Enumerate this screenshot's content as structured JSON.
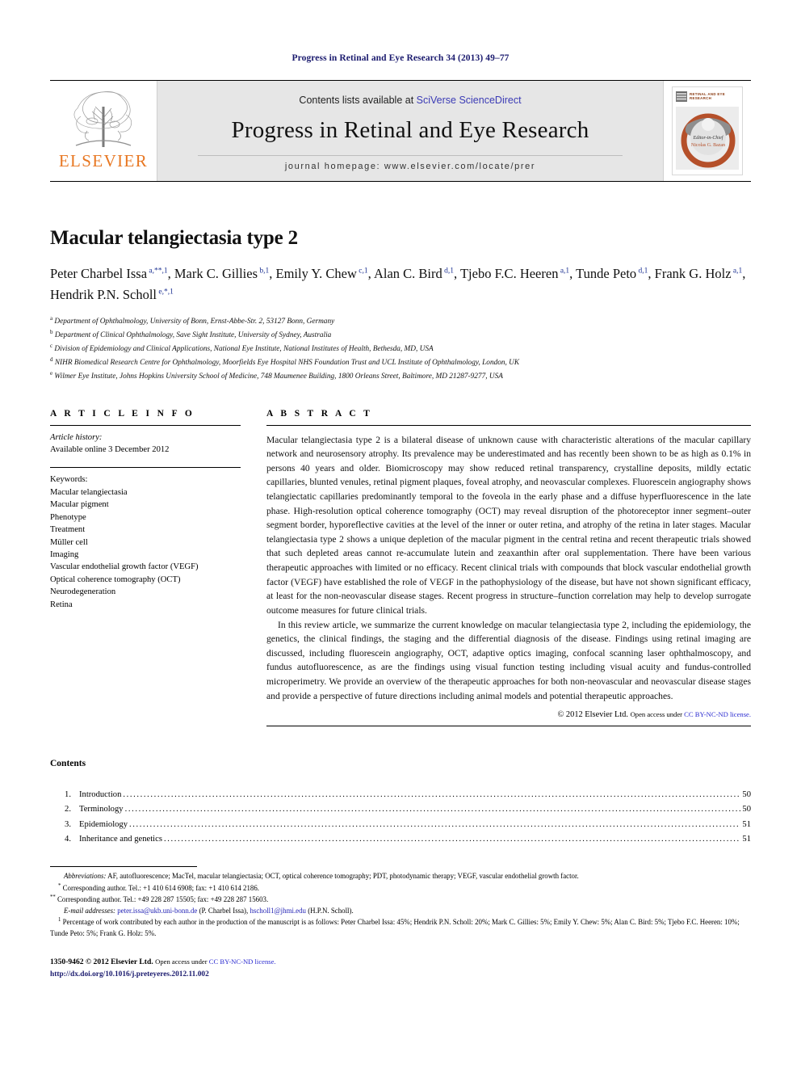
{
  "running_head": "Progress in Retinal and Eye Research 34 (2013) 49–77",
  "masthead": {
    "publisher_name": "ELSEVIER",
    "contents_prefix": "Contents lists available at ",
    "sciencedirect_link": "SciVerse ScienceDirect",
    "journal_title": "Progress in Retinal and Eye Research",
    "homepage_line": "journal homepage: www.elsevier.com/locate/prer",
    "cover_title": "RETINAL AND EYE RESEARCH",
    "cover_editor_label": "Editor-in-Chief",
    "cover_editor_name": "Nicolas G. Bazan"
  },
  "article": {
    "title": "Macular telangiectasia type 2",
    "authors": [
      {
        "name": "Peter Charbel Issa",
        "sup": "a,**,1"
      },
      {
        "name": "Mark C. Gillies",
        "sup": "b,1"
      },
      {
        "name": "Emily Y. Chew",
        "sup": "c,1"
      },
      {
        "name": "Alan C. Bird",
        "sup": "d,1"
      },
      {
        "name": "Tjebo F.C. Heeren",
        "sup": "a,1"
      },
      {
        "name": "Tunde Peto",
        "sup": "d,1"
      },
      {
        "name": "Frank G. Holz",
        "sup": "a,1"
      },
      {
        "name": "Hendrik P.N. Scholl",
        "sup": "e,*,1"
      }
    ],
    "affiliations": [
      {
        "label": "a",
        "text": "Department of Ophthalmology, University of Bonn, Ernst-Abbe-Str. 2, 53127 Bonn, Germany"
      },
      {
        "label": "b",
        "text": "Department of Clinical Ophthalmology, Save Sight Institute, University of Sydney, Australia"
      },
      {
        "label": "c",
        "text": "Division of Epidemiology and Clinical Applications, National Eye Institute, National Institutes of Health, Bethesda, MD, USA"
      },
      {
        "label": "d",
        "text": "NIHR Biomedical Research Centre for Ophthalmology, Moorfields Eye Hospital NHS Foundation Trust and UCL Institute of Ophthalmology, London, UK"
      },
      {
        "label": "e",
        "text": "Wilmer Eye Institute, Johns Hopkins University School of Medicine, 748 Maumenee Building, 1800 Orleans Street, Baltimore, MD 21287-9277, USA"
      }
    ]
  },
  "article_info": {
    "heading": "A R T I C L E    I N F O",
    "history_label": "Article history:",
    "history_value": "Available online 3 December 2012",
    "keywords_label": "Keywords:",
    "keywords": [
      "Macular telangiectasia",
      "Macular pigment",
      "Phenotype",
      "Treatment",
      "Müller cell",
      "Imaging",
      "Vascular endothelial growth factor (VEGF)",
      "Optical coherence tomography (OCT)",
      "Neurodegeneration",
      "Retina"
    ]
  },
  "abstract": {
    "heading": "A B S T R A C T",
    "paragraph_1": "Macular telangiectasia type 2 is a bilateral disease of unknown cause with characteristic alterations of the macular capillary network and neurosensory atrophy. Its prevalence may be underestimated and has recently been shown to be as high as 0.1% in persons 40 years and older. Biomicroscopy may show reduced retinal transparency, crystalline deposits, mildly ectatic capillaries, blunted venules, retinal pigment plaques, foveal atrophy, and neovascular complexes. Fluorescein angiography shows telangiectatic capillaries predominantly temporal to the foveola in the early phase and a diffuse hyperfluorescence in the late phase. High-resolution optical coherence tomography (OCT) may reveal disruption of the photoreceptor inner segment–outer segment border, hyporeflective cavities at the level of the inner or outer retina, and atrophy of the retina in later stages. Macular telangiectasia type 2 shows a unique depletion of the macular pigment in the central retina and recent therapeutic trials showed that such depleted areas cannot re-accumulate lutein and zeaxanthin after oral supplementation. There have been various therapeutic approaches with limited or no efficacy. Recent clinical trials with compounds that block vascular endothelial growth factor (VEGF) have established the role of VEGF in the pathophysiology of the disease, but have not shown significant efficacy, at least for the non-neovascular disease stages. Recent progress in structure–function correlation may help to develop surrogate outcome measures for future clinical trials.",
    "paragraph_2": "In this review article, we summarize the current knowledge on macular telangiectasia type 2, including the epidemiology, the genetics, the clinical findings, the staging and the differential diagnosis of the disease. Findings using retinal imaging are discussed, including fluorescein angiography, OCT, adaptive optics imaging, confocal scanning laser ophthalmoscopy, and fundus autofluorescence, as are the findings using visual function testing including visual acuity and fundus-controlled microperimetry. We provide an overview of the therapeutic approaches for both non-neovascular and neovascular disease stages and provide a perspective of future directions including animal models and potential therapeutic approaches.",
    "copyright_main": "© 2012 Elsevier Ltd.",
    "copyright_open_access": "Open access under ",
    "copyright_license": "CC BY-NC-ND license."
  },
  "contents": {
    "heading": "Contents",
    "entries": [
      {
        "num": "1.",
        "label": "Introduction",
        "page": "50"
      },
      {
        "num": "2.",
        "label": "Terminology",
        "page": "50"
      },
      {
        "num": "3.",
        "label": "Epidemiology",
        "page": "51"
      },
      {
        "num": "4.",
        "label": "Inheritance and genetics",
        "page": "51"
      }
    ]
  },
  "footnotes": {
    "abbreviations_label": "Abbreviations:",
    "abbreviations_text": "AF, autofluorescence; MacTel, macular telangiectasia; OCT, optical coherence tomography; PDT, photodynamic therapy; VEGF, vascular endothelial growth factor.",
    "corresponding_1_mark": "*",
    "corresponding_1": "Corresponding author. Tel.: +1 410 614 6908; fax: +1 410 614 2186.",
    "corresponding_2_mark": "**",
    "corresponding_2": "Corresponding author. Tel.: +49 228 287 15505; fax: +49 228 287 15603.",
    "email_label": "E-mail addresses:",
    "email_1": "peter.issa@ukb.uni-bonn.de",
    "email_1_owner": " (P. Charbel Issa), ",
    "email_2": "hscholl1@jhmi.edu",
    "email_2_owner": " (H.P.N. Scholl).",
    "contribution_mark": "1",
    "contribution_text": "Percentage of work contributed by each author in the production of the manuscript is as follows: Peter Charbel Issa: 45%; Hendrik P.N. Scholl: 20%; Mark C. Gillies: 5%; Emily Y. Chew: 5%; Alan C. Bird: 5%; Tjebo F.C. Heeren: 10%; Tunde Peto: 5%; Frank G. Holz: 5%."
  },
  "footer": {
    "issn": "1350-9462",
    "copyright": "© 2012 Elsevier Ltd.",
    "open_access": "Open access under ",
    "license": "CC BY-NC-ND license.",
    "doi": "http://dx.doi.org/10.1016/j.preteyeres.2012.11.002"
  },
  "colors": {
    "running_head": "#1a1a6e",
    "link_blue": "#2a2ad0",
    "elsevier_orange": "#E87722",
    "cover_rust": "#b5502a"
  }
}
